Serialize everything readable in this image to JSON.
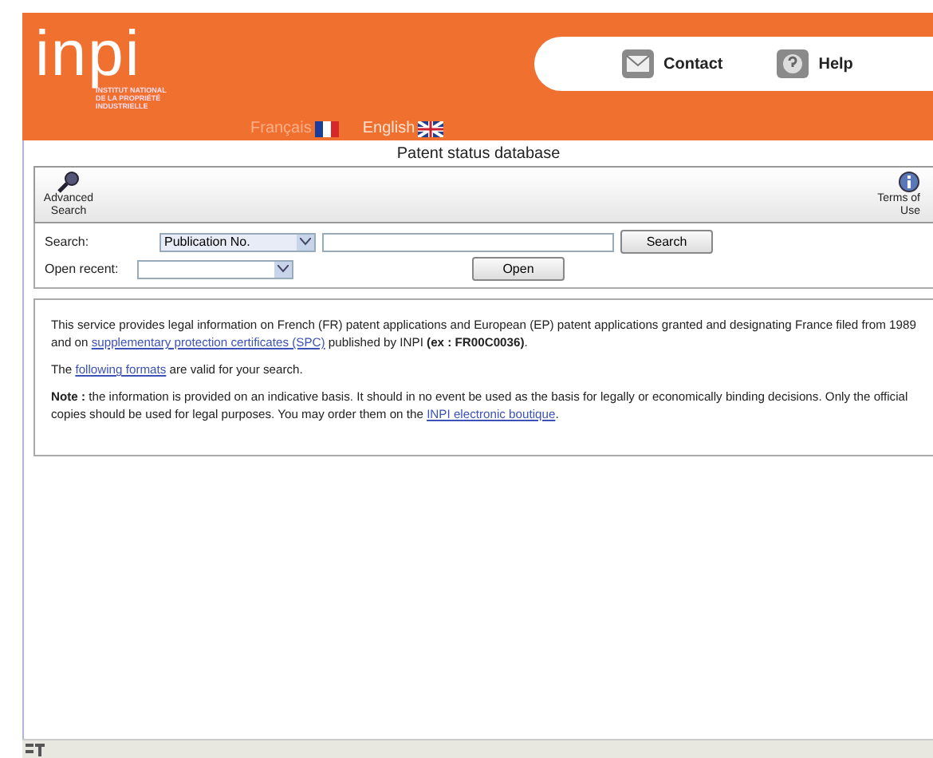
{
  "header": {
    "logo": "inpi",
    "logo_subtitle": [
      "INSTITUT NATIONAL",
      "DE LA PROPRIÉTÉ",
      "INDUSTRIELLE"
    ],
    "links": [
      {
        "label": "Contact",
        "kind": "mail"
      },
      {
        "label": "Help",
        "kind": "help"
      }
    ],
    "languages": [
      {
        "label": "Français",
        "kind": "fr",
        "selected": false
      },
      {
        "label": "English",
        "kind": "en",
        "selected": true
      }
    ]
  },
  "page_title": "Patent status database",
  "toolbar": [
    {
      "label": "Advanced Search",
      "kind": "search"
    },
    {
      "label": "Terms of Use",
      "kind": "info"
    }
  ],
  "search": {
    "label": "Search:",
    "type_value": "Publication No.",
    "button": "Search"
  },
  "recent": {
    "label": "Open recent:",
    "button": "Open"
  },
  "paragraphs": [
    [
      {
        "text": "This service provides legal information on French (FR) patent applications and European (EP) patent applications granted and designating France filed from 1989 and on "
      },
      {
        "text": "supplementary protection certificates (SPC)",
        "link": true
      },
      {
        "text": " published by INPI **(ex : FR00C0036)**."
      }
    ],
    [
      {
        "text": "The "
      },
      {
        "text": "following formats",
        "link": true
      },
      {
        "text": " are valid for your search."
      }
    ],
    [
      {
        "text": "**Note :** the information is provided on an indicative basis. It should in no event be used as the basis for legally or economically binding decisions. Only the official copies should be used for legal purposes. You may order them on the "
      },
      {
        "text": "INPI electronic boutique",
        "link": true
      },
      {
        "text": "."
      }
    ]
  ]
}
